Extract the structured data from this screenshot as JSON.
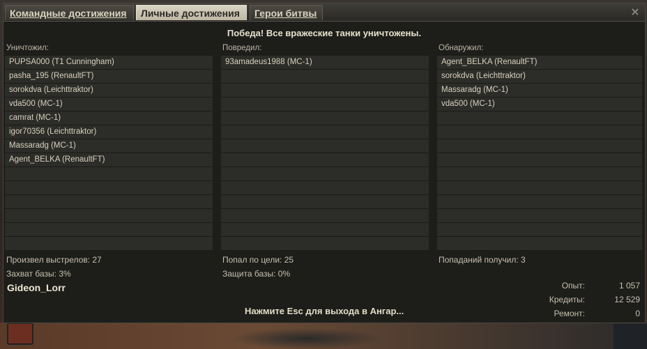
{
  "tabs": [
    {
      "label": "Командные достижения",
      "active": false
    },
    {
      "label": "Личные достижения",
      "active": true
    },
    {
      "label": "Герои битвы",
      "active": false
    }
  ],
  "close_icon": "×",
  "headline": "Победа! Все вражеские танки уничтожены.",
  "columns": {
    "destroyed": {
      "title": "Уничтожил:",
      "items": [
        "PUPSA000 (T1 Cunningham)",
        "pasha_195 (RenaultFT)",
        "sorokdva (Leichttraktor)",
        "vda500 (MC-1)",
        "camrat (MC-1)",
        "igor70356 (Leichttraktor)",
        "Massaradg (MC-1)",
        "Agent_BELKA (RenaultFT)"
      ]
    },
    "damaged": {
      "title": "Повредил:",
      "items": [
        "93amadeus1988 (MC-1)"
      ]
    },
    "spotted": {
      "title": "Обнаружил:",
      "items": [
        "Agent_BELKA (RenaultFT)",
        "sorokdva (Leichttraktor)",
        "Massaradg (MC-1)",
        "vda500 (MC-1)"
      ]
    }
  },
  "stats": {
    "shots": "Произвел выстрелов: 27",
    "hits": "Попал по цели: 25",
    "hits_received": "Попаданий получил: 3",
    "capture": "Захват базы: 3%",
    "defense": "Защита базы: 0%"
  },
  "player_name": "Gideon_Lorr",
  "rewards": [
    {
      "label": "Опыт:",
      "value": "1 057"
    },
    {
      "label": "Кредиты:",
      "value": "12 529"
    },
    {
      "label": "Ремонт:",
      "value": "0"
    }
  ],
  "footer_hint": "Нажмите Esc для выхода в Ангар..."
}
